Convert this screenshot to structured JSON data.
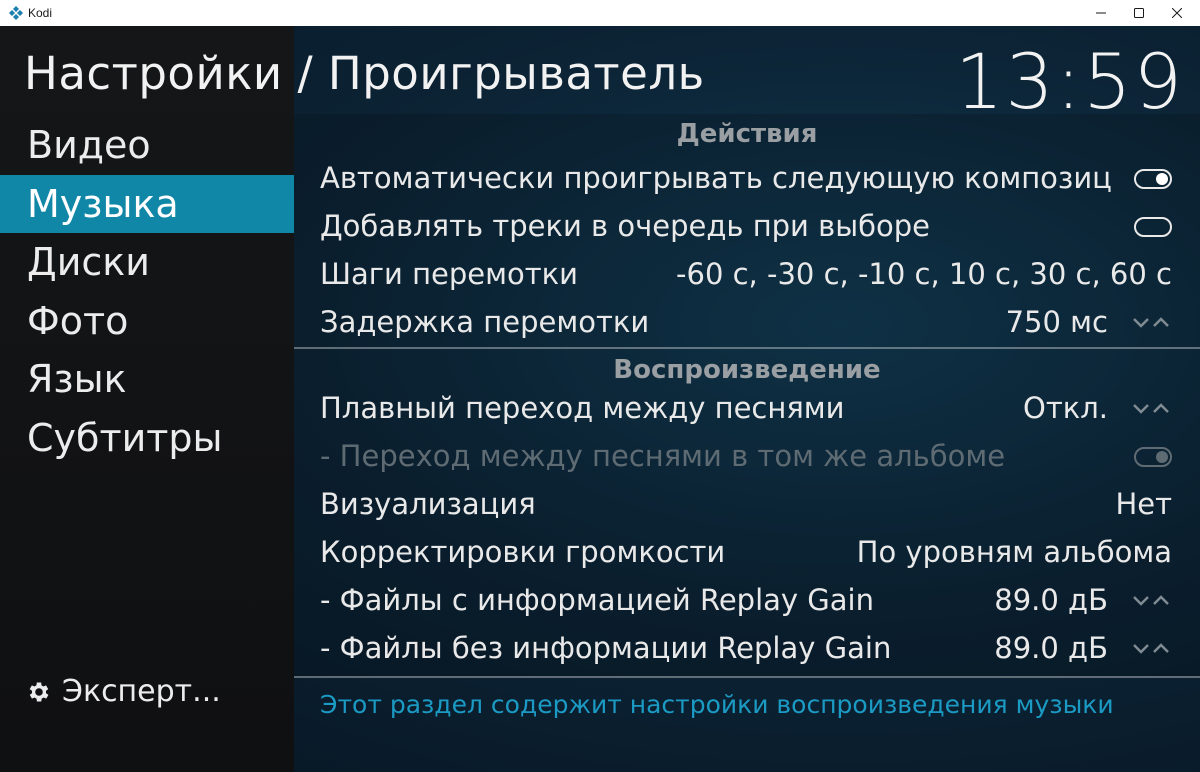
{
  "window": {
    "title": "Kodi"
  },
  "header": {
    "title": "Настройки / Проигрыватель",
    "clock": "13:59"
  },
  "sidebar": {
    "items": [
      {
        "label": "Видео"
      },
      {
        "label": "Музыка"
      },
      {
        "label": "Диски"
      },
      {
        "label": "Фото"
      },
      {
        "label": "Язык"
      },
      {
        "label": "Субтитры"
      }
    ],
    "active_index": 1,
    "expert_label": "Эксперт..."
  },
  "sections": {
    "actions": {
      "title": "Действия",
      "rows": [
        {
          "label": "Автоматически проигрывать следующую композиц",
          "control": "toggle",
          "state": "on"
        },
        {
          "label": "Добавлять треки в очередь при выборе",
          "control": "toggle",
          "state": "off"
        },
        {
          "label": "Шаги перемотки",
          "value": "-60 с, -30 с, -10 с, 10 с, 30 с, 60 с"
        },
        {
          "label": "Задержка перемотки",
          "value": "750 мс",
          "control": "spinner"
        }
      ]
    },
    "playback": {
      "title": "Воспроизведение",
      "rows": [
        {
          "label": "Плавный переход между песнями",
          "value": "Откл.",
          "control": "spinner"
        },
        {
          "label": "- Переход между песнями в том же альбоме",
          "control": "toggle",
          "state": "on",
          "disabled": true
        },
        {
          "label": "Визуализация",
          "value": "Нет"
        },
        {
          "label": "Корректировки громкости",
          "value": "По уровням альбома"
        },
        {
          "label": "- Файлы с информацией Replay Gain",
          "value": "89.0 дБ",
          "control": "spinner"
        },
        {
          "label": "- Файлы без информации Replay Gain",
          "value": "89.0 дБ",
          "control": "spinner"
        }
      ]
    }
  },
  "footer": {
    "description": "Этот раздел содержит настройки воспроизведения музыки"
  },
  "colors": {
    "accent": "#1187a8",
    "footer_text": "#1b9ac4",
    "section_header": "#9a9fa3",
    "disabled_text": "#5f6b73"
  },
  "icons": {
    "app": "kodi-logo-icon",
    "expert": "gear-icon",
    "spinner": "chevron-down-up-icon"
  }
}
